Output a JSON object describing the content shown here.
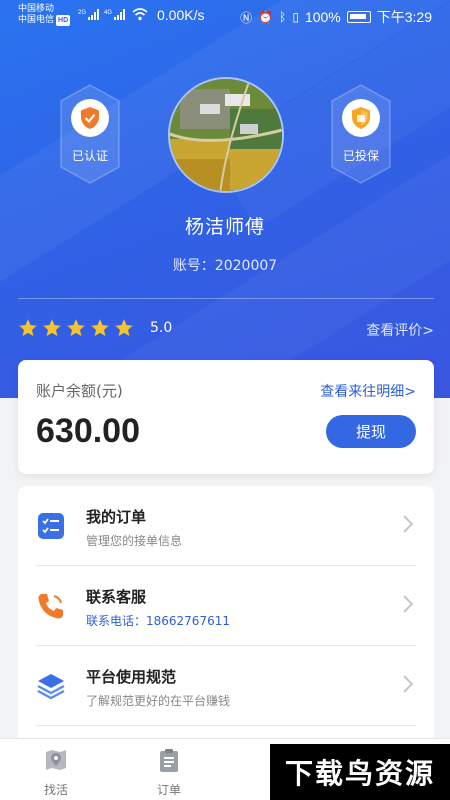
{
  "status_bar": {
    "carrier_1": "中国移动",
    "carrier_2": "中国电信",
    "hd": "HD",
    "net_1": "2G",
    "net_2": "4G",
    "speed": "0.00K/s",
    "battery": "100%",
    "time": "下午3:29"
  },
  "profile": {
    "badge_left": "已认证",
    "badge_right": "已投保",
    "name": "杨洁师傅",
    "account": "账号：2020007",
    "rating_stars": 5,
    "rating_score": "5.0",
    "view_reviews": "查看评价>"
  },
  "balance": {
    "label": "账户余额(元)",
    "detail_link": "查看来往明细>",
    "amount": "630.00",
    "withdraw_button": "提现"
  },
  "menu": [
    {
      "title": "我的订单",
      "subtitle": "管理您的接单信息",
      "icon": "order-list-icon"
    },
    {
      "title": "联系客服",
      "subtitle": "联系电话：18662767611",
      "icon": "phone-icon"
    },
    {
      "title": "平台使用规范",
      "subtitle": "了解规范更好的在平台赚钱",
      "icon": "layers-icon"
    }
  ],
  "bottom_nav": [
    {
      "label": "找活",
      "icon": "map-pin-icon"
    },
    {
      "label": "订单",
      "icon": "clipboard-icon"
    }
  ],
  "watermark": "下载鸟资源",
  "colors": {
    "primary": "#3468e3",
    "star": "#f5c32a",
    "badge_left_icon": "#f07a2a",
    "badge_right_icon": "#f5a623"
  }
}
